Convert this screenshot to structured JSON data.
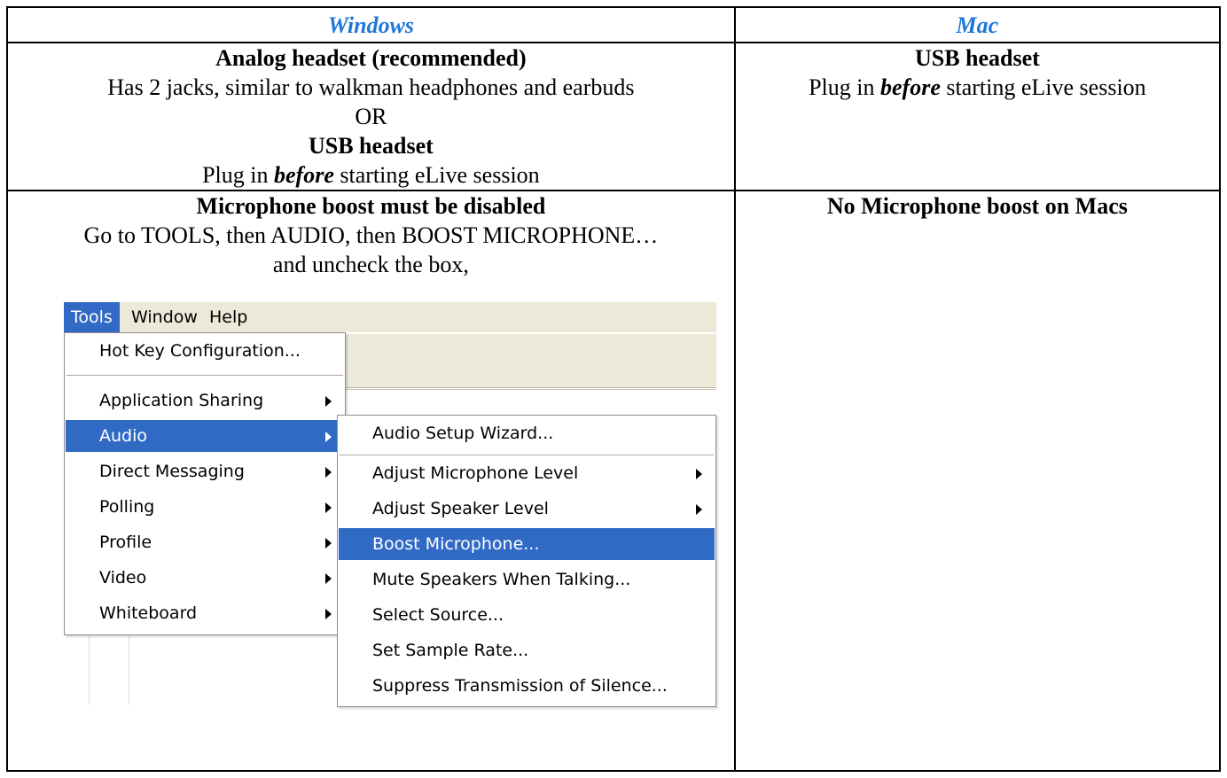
{
  "header": {
    "windows": "Windows",
    "mac": "Mac"
  },
  "row1": {
    "windows": {
      "analog_title": "Analog headset (recommended)",
      "analog_desc": "Has 2 jacks, similar to walkman headphones and earbuds",
      "or": "OR",
      "usb_title": "USB headset",
      "plug_pre": "Plug in ",
      "plug_em": "before",
      "plug_post": " starting eLive session"
    },
    "mac": {
      "usb_title": "USB headset",
      "plug_pre": "Plug in ",
      "plug_em": "before",
      "plug_post": " starting eLive session"
    }
  },
  "row2": {
    "windows": {
      "title": "Microphone boost must be disabled",
      "instr1": "Go to TOOLS, then AUDIO, then BOOST MICROPHONE…",
      "instr2": "and uncheck the box,"
    },
    "mac": {
      "title": "No Microphone boost on Macs"
    }
  },
  "screenshot": {
    "menubar": [
      "Tools",
      "Window",
      "Help"
    ],
    "tools_menu": {
      "hotkey": "Hot Key Configuration...",
      "items": [
        "Application Sharing",
        "Audio",
        "Direct Messaging",
        "Polling",
        "Profile",
        "Video",
        "Whiteboard"
      ]
    },
    "audio_menu": [
      "Audio Setup Wizard...",
      "Adjust Microphone Level",
      "Adjust Speaker Level",
      "Boost Microphone...",
      "Mute Speakers When Talking...",
      "Select Source...",
      "Set Sample Rate...",
      "Suppress Transmission of Silence..."
    ],
    "highlight_color": "#316ac5",
    "menubar_color": "#ece9d8"
  }
}
